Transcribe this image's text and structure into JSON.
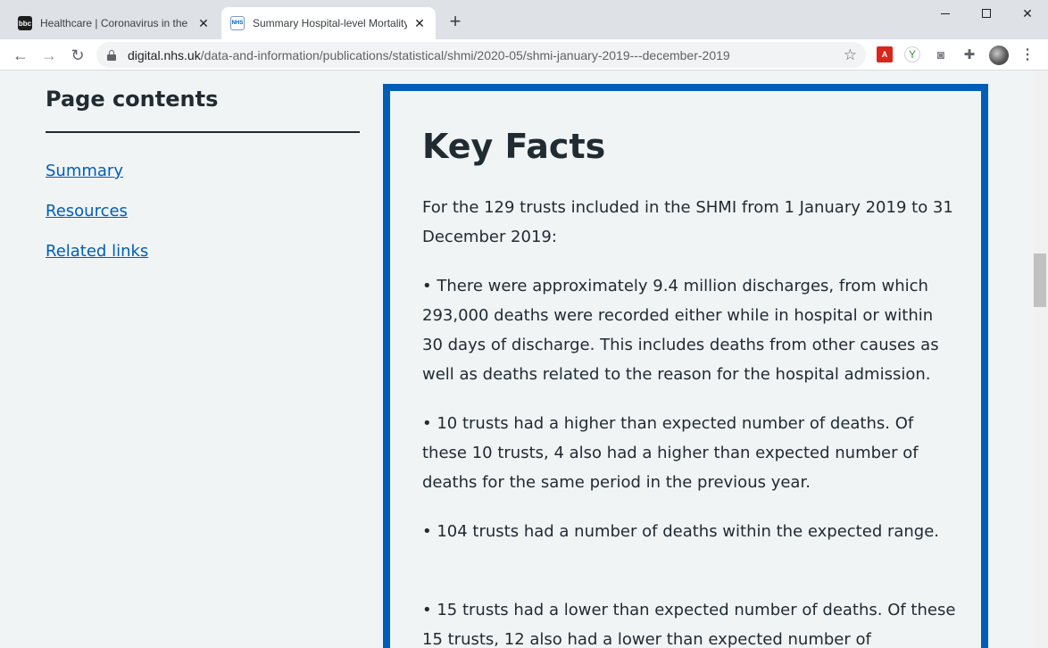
{
  "browser": {
    "tabs": [
      {
        "title": "Healthcare | Coronavirus in the UK",
        "favicon": "bbc-icon",
        "active": false
      },
      {
        "title": "Summary Hospital-level Mortality Indicator",
        "favicon": "nhs-digital-icon",
        "active": true
      }
    ],
    "url_host": "digital.nhs.uk",
    "url_path": "/data-and-information/publications/statistical/shmi/2020-05/shmi-january-2019---december-2019"
  },
  "page_contents": {
    "heading": "Page contents",
    "links": [
      "Summary",
      "Resources",
      "Related links"
    ]
  },
  "key_facts": {
    "title": "Key Facts",
    "paragraphs": [
      "For the 129 trusts included in the SHMI from 1 January 2019 to 31 December 2019:",
      "• There were approximately 9.4 million discharges, from which 293,000 deaths were recorded either while in hospital or within 30 days of discharge. This includes deaths from other causes as well as deaths related to the reason for the hospital admission.",
      "• 10 trusts had a higher than expected number of deaths.  Of these 10 trusts, 4 also had a higher than expected number of deaths for the same period in the previous year.",
      "• 104 trusts had a number of deaths within the expected range.",
      "• 15 trusts had a lower than expected number of deaths.  Of these 15 trusts, 12 also had a lower than expected number of"
    ],
    "accent_color": "#005eb8"
  },
  "colors": {
    "link": "#005eb8",
    "text": "#212b32",
    "background": "#f0f4f5"
  }
}
